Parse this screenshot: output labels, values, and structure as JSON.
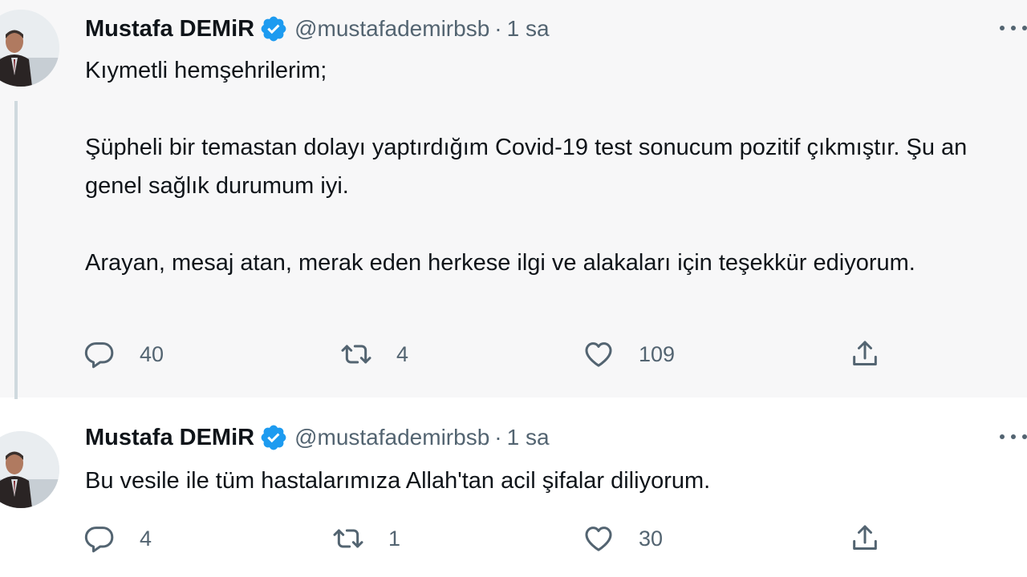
{
  "colors": {
    "verified": "#1d9bf0",
    "muted": "#536471",
    "text": "#0f1419"
  },
  "tweets": [
    {
      "author": "Mustafa DEMiR",
      "handle": "@mustafademirbsb",
      "separator": "·",
      "time": "1 sa",
      "paragraphs": [
        "Kıymetli hemşehrilerim;",
        "Şüpheli bir temastan dolayı yaptırdığım Covid-19 test sonucum pozitif çıkmıştır. Şu an genel sağlık durumum iyi.",
        "Arayan, mesaj atan, merak eden herkese ilgi ve alakaları için teşekkür ediyorum."
      ],
      "replies": "40",
      "retweets": "4",
      "likes": "109",
      "icons": [
        "reply-icon",
        "retweet-icon",
        "like-icon",
        "share-icon",
        "verified-badge-icon",
        "more-icon"
      ]
    },
    {
      "author": "Mustafa DEMiR",
      "handle": "@mustafademirbsb",
      "separator": "·",
      "time": "1 sa",
      "paragraphs": [
        "Bu vesile ile tüm hastalarımıza Allah'tan acil şifalar diliyorum."
      ],
      "replies": "4",
      "retweets": "1",
      "likes": "30",
      "icons": [
        "reply-icon",
        "retweet-icon",
        "like-icon",
        "share-icon",
        "verified-badge-icon",
        "more-icon"
      ]
    }
  ]
}
